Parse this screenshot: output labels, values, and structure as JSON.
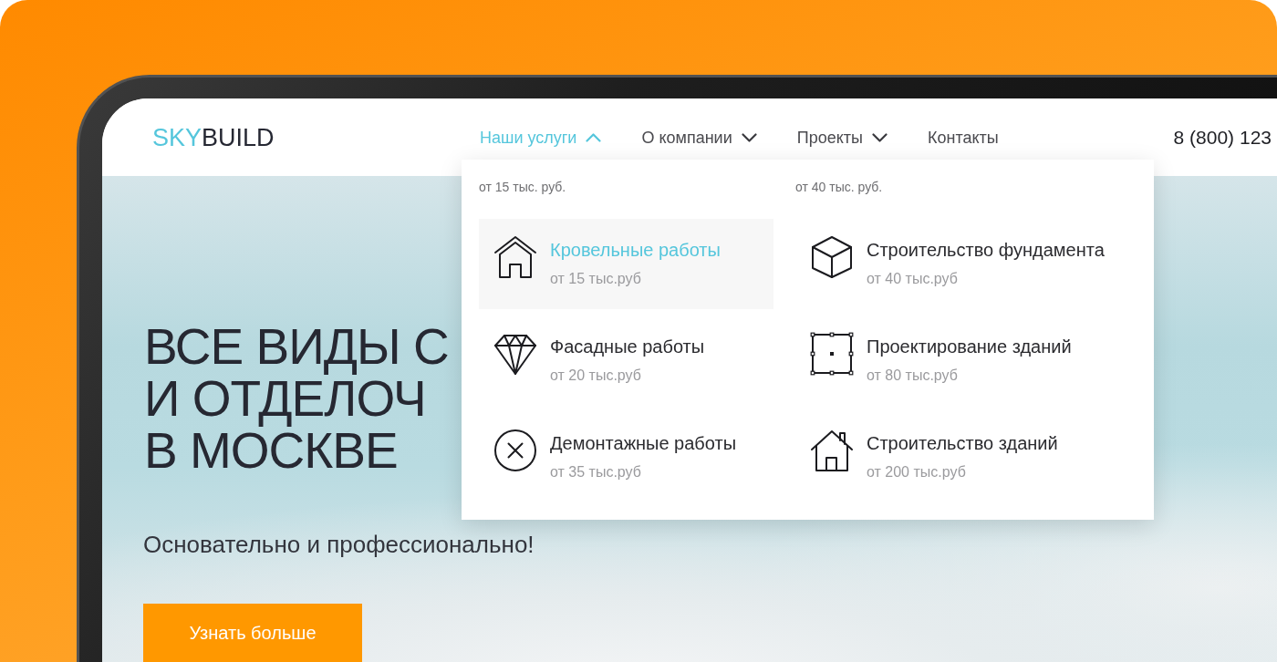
{
  "logo": {
    "accent": "SKY",
    "rest": "BUILD"
  },
  "nav": [
    {
      "label": "Наши услуги",
      "kind": "dropdown",
      "expanded": true
    },
    {
      "label": "О компании",
      "kind": "dropdown",
      "expanded": false
    },
    {
      "label": "Проекты",
      "kind": "dropdown",
      "expanded": false
    },
    {
      "label": "Контакты",
      "kind": "link",
      "expanded": false
    }
  ],
  "phone": "8 (800) 123",
  "dropdown": {
    "columns": [
      {
        "heading": "от 15 тыс. руб.",
        "items": [
          {
            "kind": "roofing",
            "title": "Кровельные работы",
            "price": "от 15 тыс.руб",
            "selected": true
          },
          {
            "kind": "facade",
            "title": "Фасадные работы",
            "price": "от 20 тыс.руб",
            "selected": false
          },
          {
            "kind": "demolition",
            "title": "Демонтажные работы",
            "price": "от 35 тыс.руб",
            "selected": false
          }
        ]
      },
      {
        "heading": "от 40 тыс. руб.",
        "items": [
          {
            "kind": "foundation",
            "title": "Строительство фундамента",
            "price": "от 40 тыс.руб",
            "selected": false
          },
          {
            "kind": "design",
            "title": "Проектирование зданий",
            "price": "от 80 тыс.руб",
            "selected": false
          },
          {
            "kind": "construction",
            "title": "Строительство зданий",
            "price": "от 200 тыс.руб",
            "selected": false
          }
        ]
      }
    ]
  },
  "hero": {
    "headline": [
      "ВСЕ ВИДЫ С",
      "И ОТДЕЛОЧ",
      "В МОСКВЕ"
    ],
    "subtitle": "Основательно и профессионально!",
    "button": "Узнать больше"
  }
}
